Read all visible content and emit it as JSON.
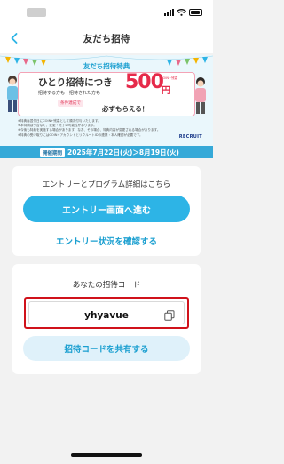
{
  "nav": {
    "title": "友だち招待"
  },
  "banner": {
    "title": "友だち招待特典",
    "headline": "ひとり招待につき",
    "subline": "招待する方も・招待された方も",
    "condition": "条件達成で",
    "amount": "500",
    "amount_unit": "円",
    "amount_note": "COIN+残高",
    "message": "必ずもらえる！",
    "notes": [
      "※特典は翌付日にCOIN+残高として順次付与いたします。",
      "※本特典は予告なく、変更・終了の可能性があります。",
      "※今後も特典を実施する場合があります。なお、その場合、特典内容が変更される場合があります。",
      "※特典の受け取りにはCOIN+アカウントとリクルートIDの連携・本人確認が必要です。"
    ],
    "brand": "RECRUIT"
  },
  "period": {
    "tag": "開催期間",
    "dates": "2025年7月22日(火)＞8月19日(火)"
  },
  "entry_card": {
    "title": "エントリーとプログラム詳細はこちら",
    "primary_button": "エントリー画面へ進む",
    "status_link": "エントリー状況を確認する"
  },
  "invite_card": {
    "title": "あなたの招待コード",
    "code": "yhyavue",
    "share_button": "招待コードを共有する"
  },
  "colors": {
    "accent": "#2db4e6",
    "link": "#1a9fd0",
    "highlight": "#d0121b",
    "promo_red": "#e62a4a"
  }
}
